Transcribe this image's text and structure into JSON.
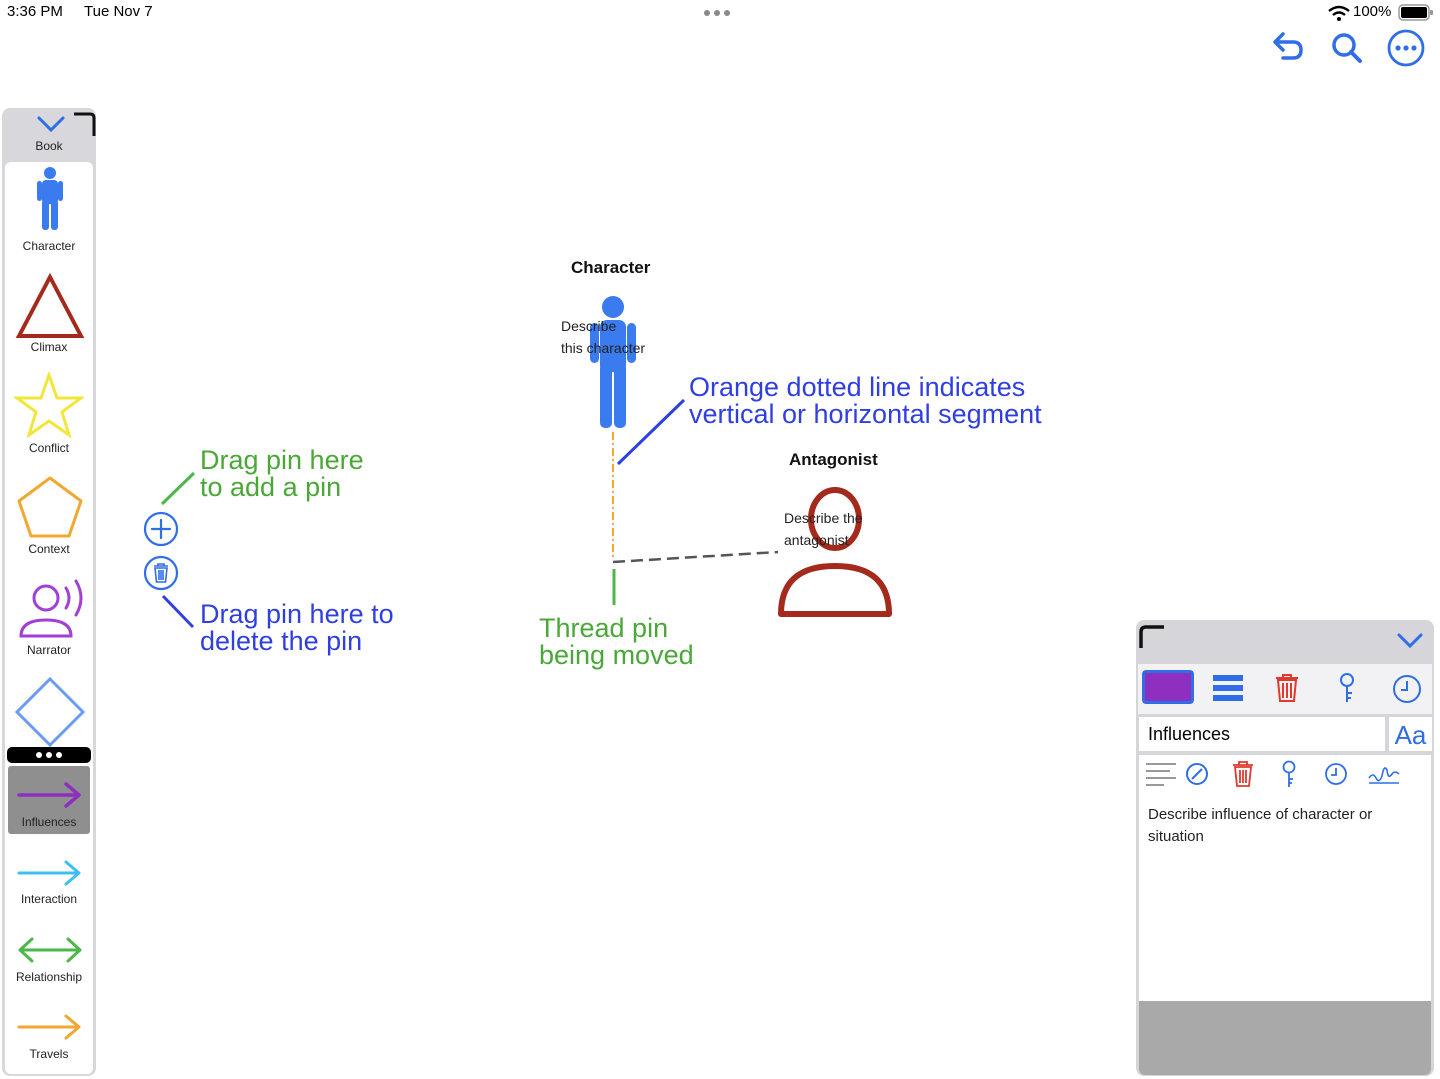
{
  "status_bar": {
    "time": "3:36 PM",
    "date": "Tue Nov 7",
    "battery": "100%",
    "icons": [
      "wifi-icon",
      "battery-icon"
    ]
  },
  "toolbar": {
    "icons": [
      "undo-icon",
      "search-icon",
      "more-icon"
    ],
    "accent_color": "#2f6ee6"
  },
  "palette": {
    "top_label": "Book",
    "items": [
      {
        "label": "Character",
        "icon": "character-icon",
        "color": "#3a7bf0"
      },
      {
        "label": "Climax",
        "icon": "triangle-icon",
        "color": "#a32a1c"
      },
      {
        "label": "Conflict",
        "icon": "star-icon",
        "color": "#f2e63a"
      },
      {
        "label": "Context",
        "icon": "pentagon-icon",
        "color": "#f0a830"
      },
      {
        "label": "Narrator",
        "icon": "narrator-icon",
        "color": "#a13fd6"
      },
      {
        "label": "",
        "icon": "diamond-icon",
        "color": "#6b9cf5"
      },
      {
        "label": "Influences",
        "icon": "arrow-right-icon",
        "color": "#8e2fc0"
      },
      {
        "label": "Interaction",
        "icon": "arrow-right-icon",
        "color": "#3cc0f0"
      },
      {
        "label": "Relationship",
        "icon": "double-arrow-icon",
        "color": "#4cb848"
      },
      {
        "label": "Travels",
        "icon": "arrow-right-icon",
        "color": "#f0a830"
      }
    ]
  },
  "canvas": {
    "character": {
      "title": "Character",
      "desc_line1": "Describe",
      "desc_line2": "this character",
      "color": "#3a7bf0"
    },
    "antagonist": {
      "title": "Antagonist",
      "desc_line1": "Describe the",
      "desc_line2": "antagonist",
      "color": "#a32a1c"
    },
    "notes": {
      "orange_line_1": "Orange dotted line indicates",
      "orange_line_2": "vertical or horizontal segment",
      "add_pin_1": "Drag pin here",
      "add_pin_2": "to add a pin",
      "delete_pin_1": "Drag pin here to",
      "delete_pin_2": "delete the pin",
      "thread_pin_1": "Thread pin",
      "thread_pin_2": "being moved"
    },
    "pin_tools": [
      "add-pin-icon",
      "delete-pin-icon"
    ]
  },
  "inspector": {
    "name": "Influences",
    "font_button": "Aa",
    "description": "Describe influence of character or situation",
    "swatch_color": "#8e2fc0",
    "toolbar_icons": [
      "color-swatch",
      "lines-icon",
      "trash-icon",
      "key-icon",
      "clock-icon"
    ],
    "text_icons": [
      "text-align-icon",
      "no-style-icon",
      "trash-icon",
      "key-icon",
      "clock-icon",
      "signature-icon"
    ]
  }
}
